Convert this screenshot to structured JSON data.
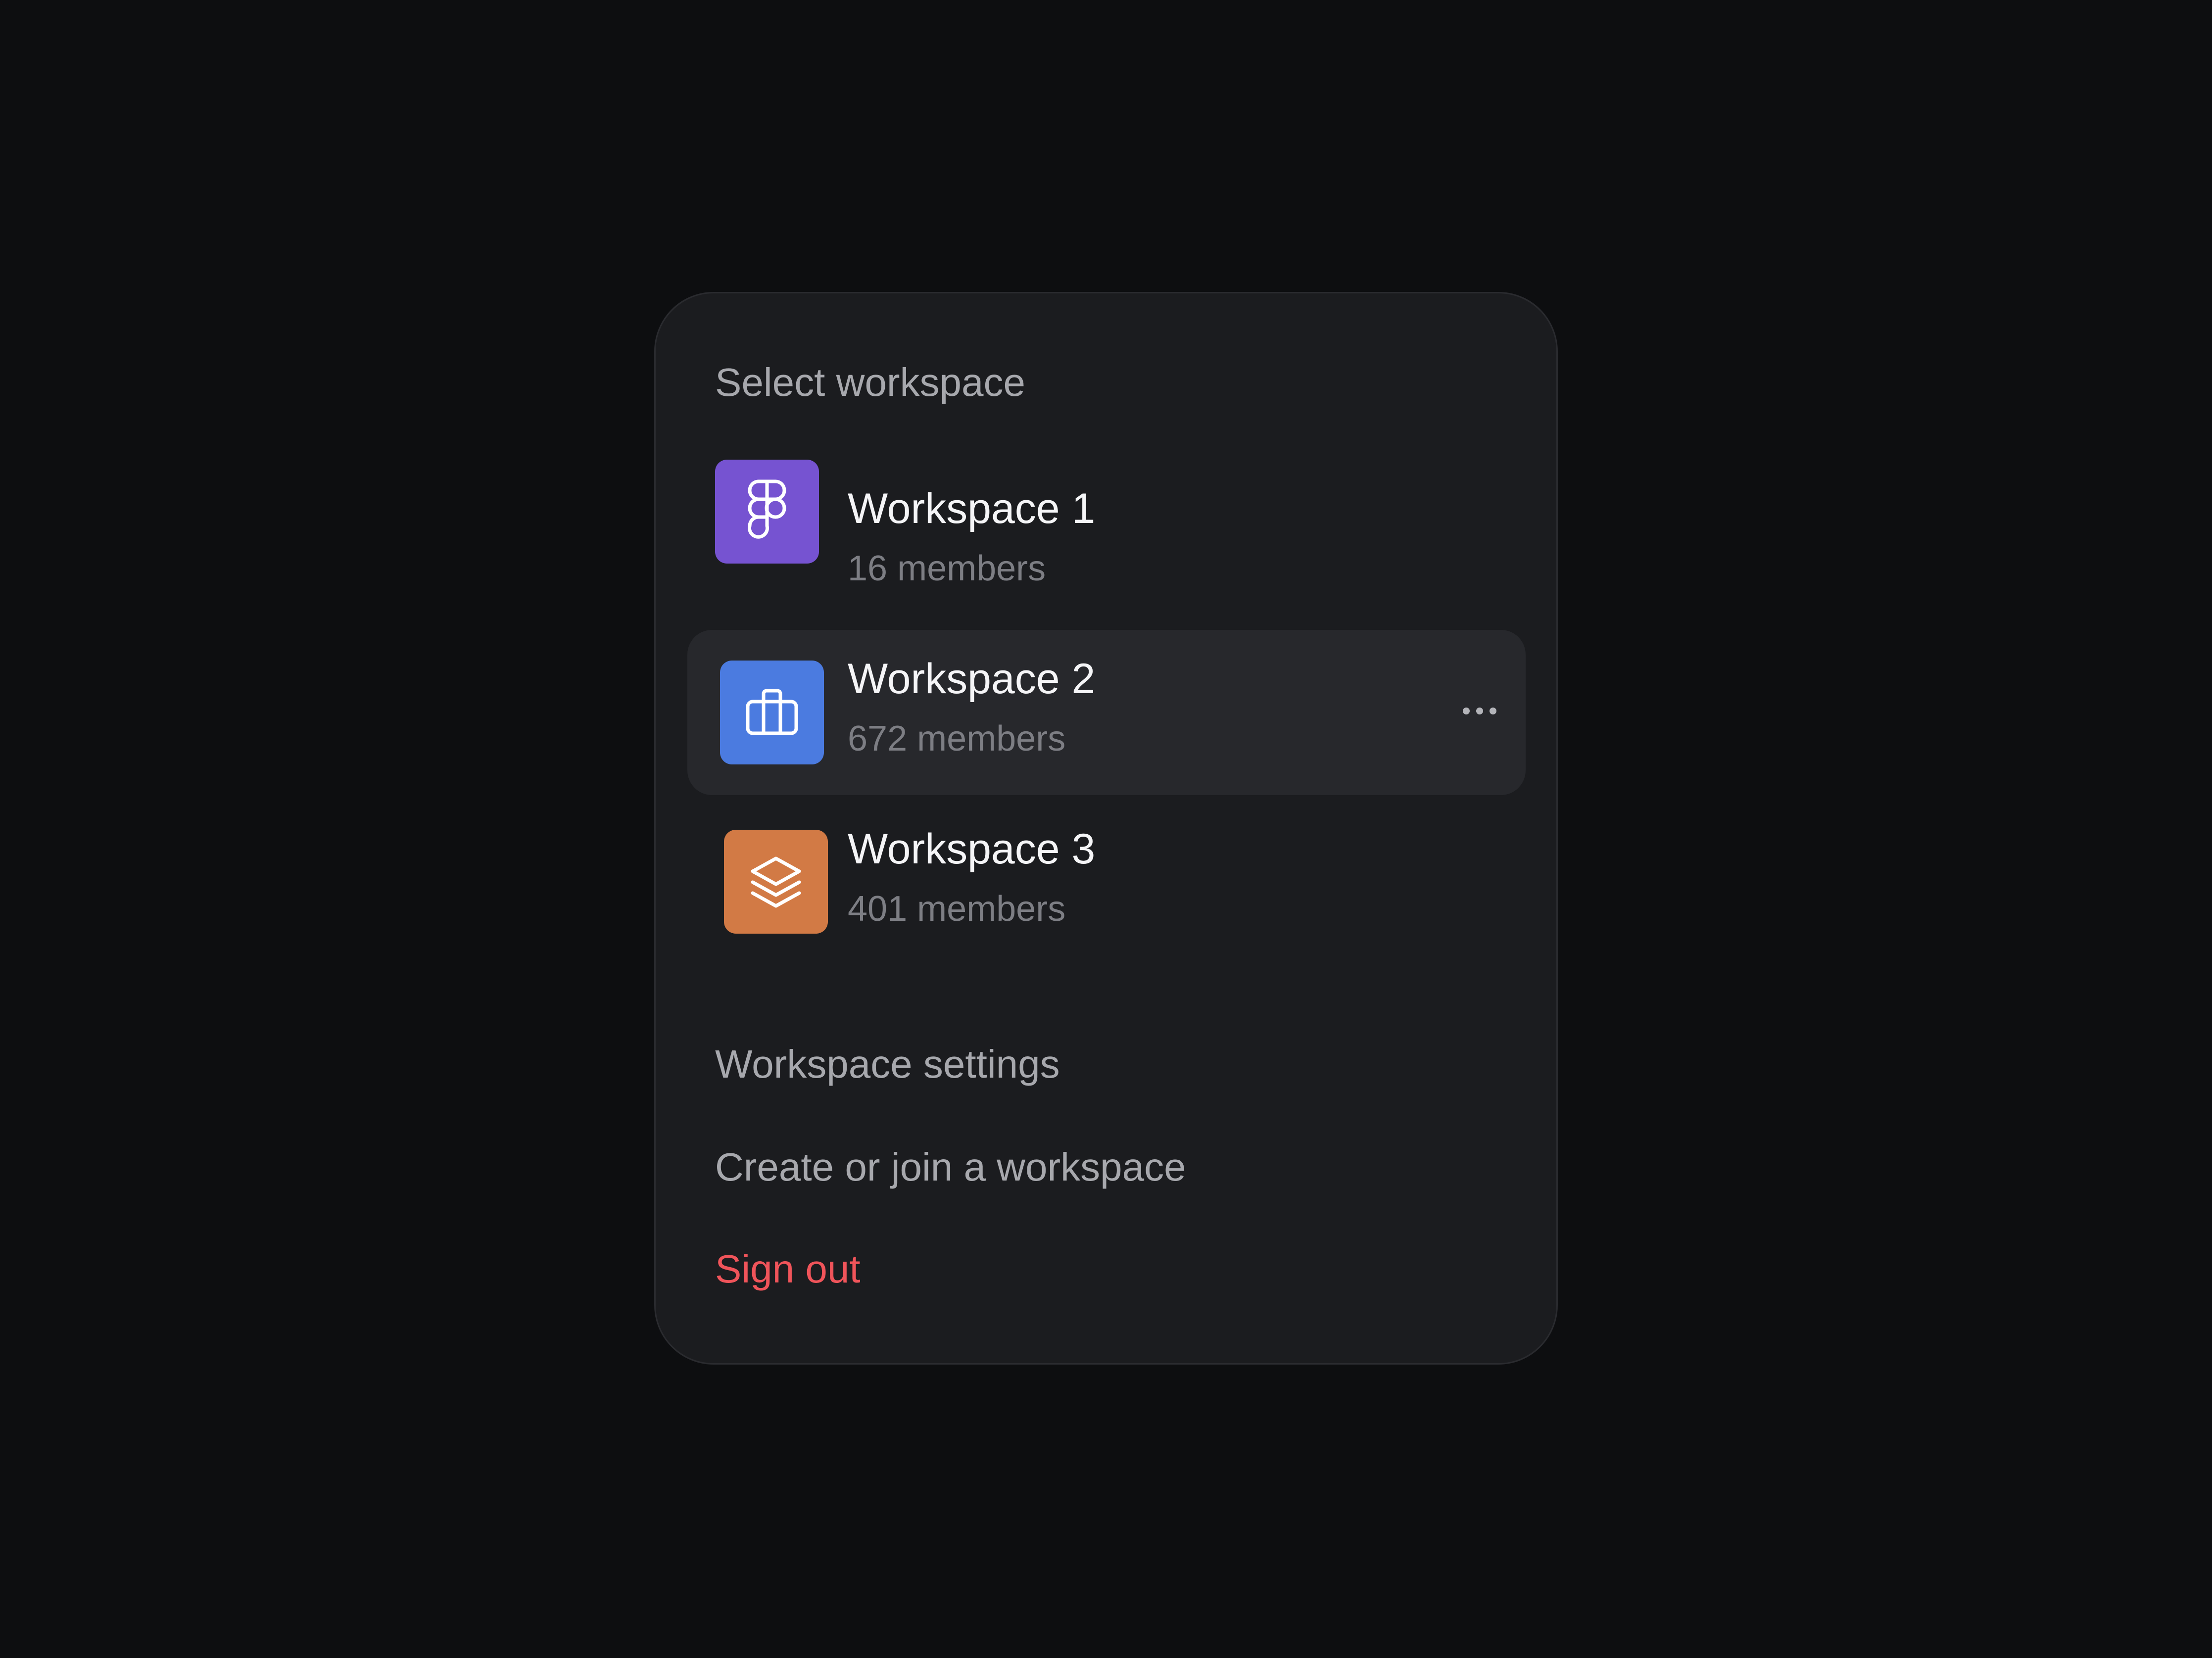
{
  "panel": {
    "title": "Select workspace",
    "workspaces": [
      {
        "name": "Workspace 1",
        "members": "16 members",
        "icon": "figma-icon",
        "color": "#7653d1"
      },
      {
        "name": "Workspace 2",
        "members": "672 members",
        "icon": "briefcase-icon",
        "color": "#4b7be0",
        "active": true,
        "more": "more-options-icon"
      },
      {
        "name": "Workspace 3",
        "members": "401 members",
        "icon": "layers-icon",
        "color": "#d27a45"
      }
    ],
    "links": {
      "settings": "Workspace settings",
      "create_join": "Create or join a workspace",
      "sign_out": "Sign out"
    },
    "colors": {
      "background": "#0d0e10",
      "panel": "#1b1c1f",
      "active_row": "#27282c",
      "danger": "#f0545a"
    }
  }
}
